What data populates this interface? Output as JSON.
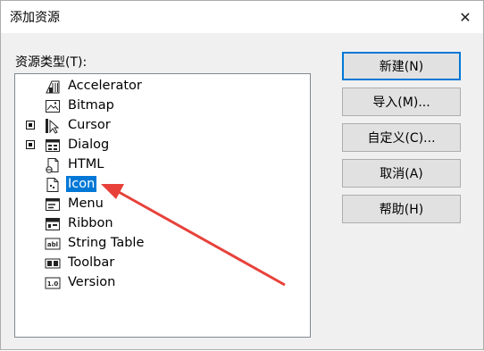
{
  "window": {
    "title": "添加资源",
    "close_glyph": "✕"
  },
  "tree": {
    "label": "资源类型(T):",
    "items": [
      {
        "label": "Accelerator",
        "icon": "accelerator-icon",
        "expandable": false,
        "selected": false
      },
      {
        "label": "Bitmap",
        "icon": "bitmap-icon",
        "expandable": false,
        "selected": false
      },
      {
        "label": "Cursor",
        "icon": "cursor-icon",
        "expandable": true,
        "selected": false
      },
      {
        "label": "Dialog",
        "icon": "dialog-icon",
        "expandable": true,
        "selected": false
      },
      {
        "label": "HTML",
        "icon": "html-icon",
        "expandable": false,
        "selected": false
      },
      {
        "label": "Icon",
        "icon": "icon-resource-icon",
        "expandable": false,
        "selected": true
      },
      {
        "label": "Menu",
        "icon": "menu-icon",
        "expandable": false,
        "selected": false
      },
      {
        "label": "Ribbon",
        "icon": "ribbon-icon",
        "expandable": false,
        "selected": false
      },
      {
        "label": "String Table",
        "icon": "string-table-icon",
        "expandable": false,
        "selected": false
      },
      {
        "label": "Toolbar",
        "icon": "toolbar-icon",
        "expandable": false,
        "selected": false
      },
      {
        "label": "Version",
        "icon": "version-icon",
        "expandable": false,
        "selected": false
      }
    ]
  },
  "buttons": {
    "new_label": "新建(N)",
    "import_label": "导入(M)...",
    "custom_label": "自定义(C)...",
    "cancel_label": "取消(A)",
    "help_label": "帮助(H)"
  },
  "colors": {
    "selection": "#0078d7",
    "annotation_arrow": "#e8413a",
    "dialog_bg": "#f0f0f0"
  }
}
